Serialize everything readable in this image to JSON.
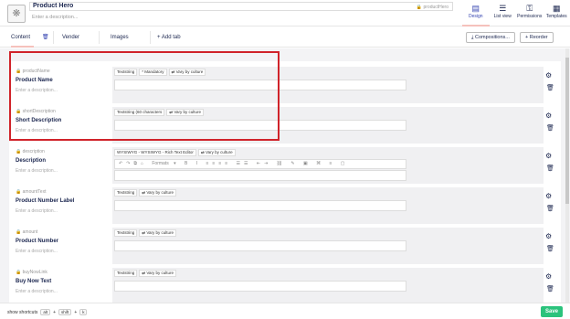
{
  "header": {
    "name": "Product Hero",
    "alias": "productHero",
    "description_placeholder": "Enter a description...",
    "modes": [
      {
        "label": "Design",
        "icon": "design-icon"
      },
      {
        "label": "List view",
        "icon": "list-view-icon"
      },
      {
        "label": "Permissions",
        "icon": "permissions-icon"
      },
      {
        "label": "Templates",
        "icon": "templates-icon"
      }
    ]
  },
  "tabs": {
    "items": [
      "Content",
      "Vender",
      "Images"
    ],
    "add_tab": "Add tab",
    "compositions": "Compositions...",
    "reorder": "Reorder"
  },
  "properties": [
    {
      "alias": "productName",
      "label": "Product Name",
      "desc": "Enter a description...",
      "tags": [
        "Textstring",
        "* Mandatory",
        "Vary by culture"
      ],
      "editor": "text"
    },
    {
      "alias": "shortDescription",
      "label": "Short Description",
      "desc": "Enter a description...",
      "tags": [
        "Textstring (60 characters",
        "Vary by culture"
      ],
      "editor": "text"
    },
    {
      "alias": "description",
      "label": "Description",
      "desc": "Enter a description...",
      "tags": [
        "WYSIWYG - WYSIWYG - Rich Text Editor",
        "Vary by culture"
      ],
      "editor": "rte",
      "rte_formats": "Formats"
    },
    {
      "alias": "amountText",
      "label": "Product Number Label",
      "desc": "Enter a description...",
      "tags": [
        "Textstring",
        "Vary by culture"
      ],
      "editor": "text"
    },
    {
      "alias": "amount",
      "label": "Product Number",
      "desc": "Enter a description...",
      "tags": [
        "Textstring",
        "Vary by culture"
      ],
      "editor": "text"
    },
    {
      "alias": "buyNowLink",
      "label": "Buy Now Text",
      "desc": "Enter a description...",
      "tags": [
        "Textstring",
        "Vary by culture"
      ],
      "editor": "text"
    }
  ],
  "footer": {
    "show_shortcuts": "show shortcuts",
    "keys": [
      "alt",
      "+",
      "shift",
      "+",
      "k"
    ],
    "save": "Save"
  },
  "colors": {
    "accent": "#3544b1",
    "highlight": "#d0232a",
    "save": "#2bc37c"
  }
}
